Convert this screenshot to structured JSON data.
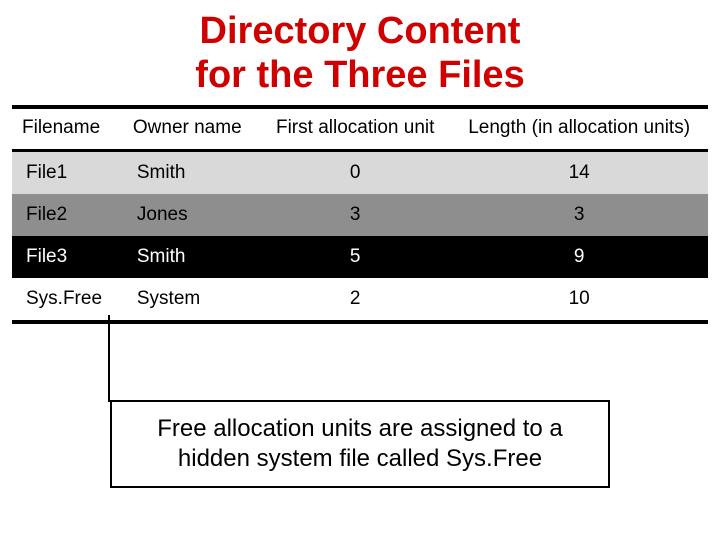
{
  "title_line1": "Directory Content",
  "title_line2": "for the Three Files",
  "table": {
    "headers": [
      "Filename",
      "Owner name",
      "First allocation unit",
      "Length (in allocation units)"
    ],
    "rows": [
      {
        "filename": "File1",
        "owner": "Smith",
        "first": "0",
        "length": "14"
      },
      {
        "filename": "File2",
        "owner": "Jones",
        "first": "3",
        "length": "3"
      },
      {
        "filename": "File3",
        "owner": "Smith",
        "first": "5",
        "length": "9"
      },
      {
        "filename": "Sys.Free",
        "owner": "System",
        "first": "2",
        "length": "10"
      }
    ]
  },
  "callout": "Free allocation units are assigned to a hidden system file called Sys.Free"
}
